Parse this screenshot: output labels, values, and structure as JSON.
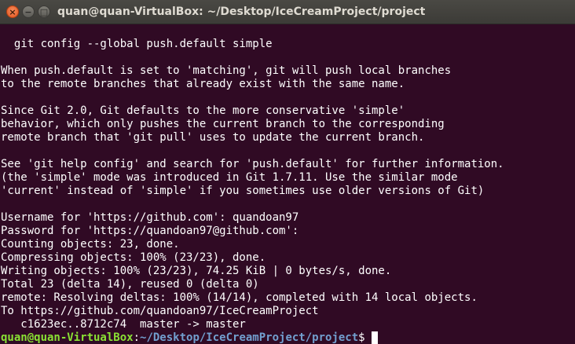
{
  "window": {
    "title": "quan@quan-VirtualBox: ~/Desktop/IceCreamProject/project",
    "close_glyph": "×",
    "minimize_glyph": "−",
    "maximize_glyph": "□"
  },
  "colors": {
    "background": "#300a24",
    "text": "#ffffff",
    "prompt_user": "#8ae234",
    "prompt_path": "#729fcf",
    "close_button": "#e2531d"
  },
  "terminal": {
    "lines": [
      "",
      "  git config --global push.default simple",
      "",
      "When push.default is set to 'matching', git will push local branches",
      "to the remote branches that already exist with the same name.",
      "",
      "Since Git 2.0, Git defaults to the more conservative 'simple'",
      "behavior, which only pushes the current branch to the corresponding",
      "remote branch that 'git pull' uses to update the current branch.",
      "",
      "See 'git help config' and search for 'push.default' for further information.",
      "(the 'simple' mode was introduced in Git 1.7.11. Use the similar mode",
      "'current' instead of 'simple' if you sometimes use older versions of Git)",
      "",
      "Username for 'https://github.com': quandoan97",
      "Password for 'https://quandoan97@github.com':",
      "Counting objects: 23, done.",
      "Compressing objects: 100% (23/23), done.",
      "Writing objects: 100% (23/23), 74.25 KiB | 0 bytes/s, done.",
      "Total 23 (delta 14), reused 0 (delta 0)",
      "remote: Resolving deltas: 100% (14/14), completed with 14 local objects.",
      "To https://github.com/quandoan97/IceCreamProject",
      "   c1623ec..8712c74  master -> master"
    ],
    "prompt": {
      "user_host": "quan@quan-VirtualBox",
      "separator": ":",
      "path": "~/Desktop/IceCreamProject/project",
      "symbol": "$ "
    }
  }
}
